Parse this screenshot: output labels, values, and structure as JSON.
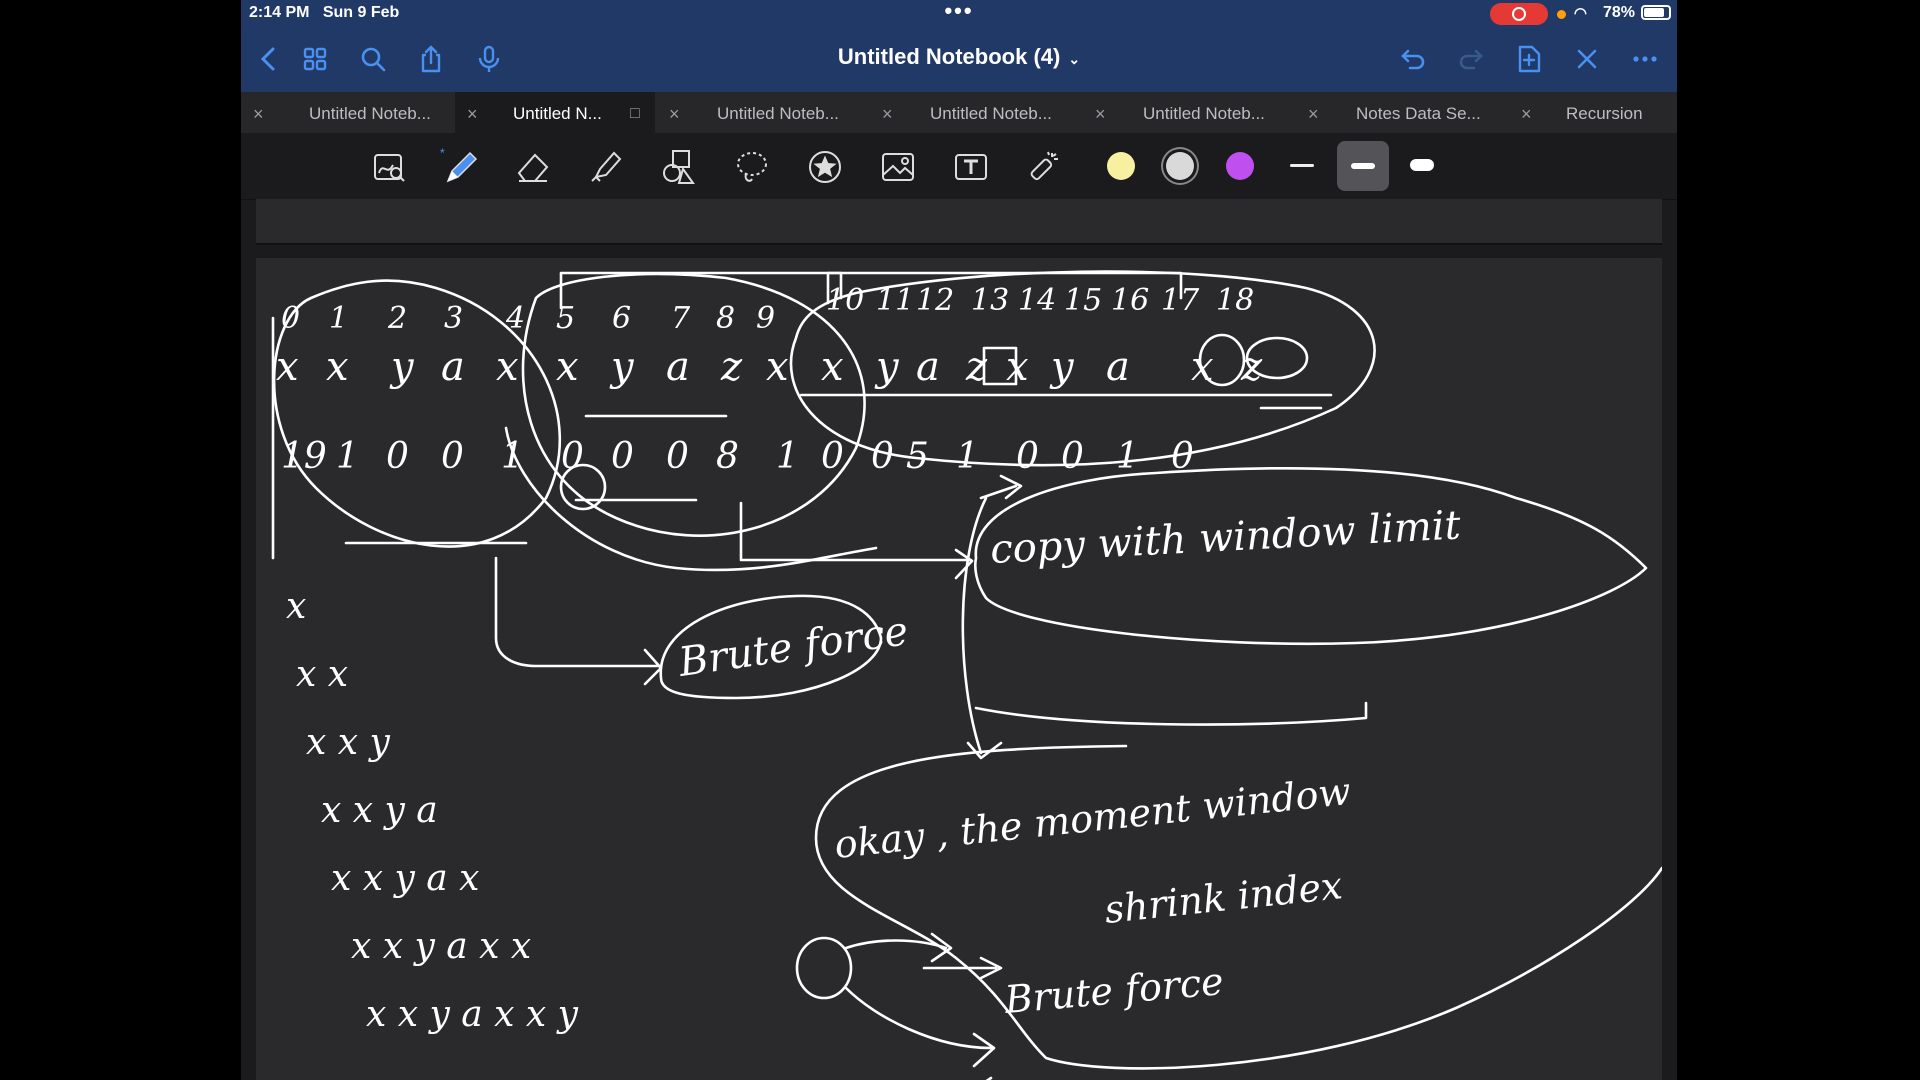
{
  "status": {
    "time": "2:14 PM",
    "date": "Sun 9 Feb",
    "battery": "78%"
  },
  "nav": {
    "title": "Untitled Notebook (4)"
  },
  "tabs": [
    {
      "label": "Untitled Noteb...",
      "active": false
    },
    {
      "label": "Untitled N...",
      "active": true
    },
    {
      "label": "Untitled Noteb...",
      "active": false
    },
    {
      "label": "Untitled Noteb...",
      "active": false
    },
    {
      "label": "Untitled Noteb...",
      "active": false
    },
    {
      "label": "Notes Data Se...",
      "active": false
    },
    {
      "label": "Recursion",
      "active": false
    }
  ],
  "toolbar": {
    "tools": [
      "zoom-window-icon",
      "pen-icon",
      "eraser-icon",
      "highlighter-icon",
      "shapes-icon",
      "lasso-icon",
      "sticker-icon",
      "image-icon",
      "text-icon",
      "laser-pointer-icon"
    ],
    "colors": [
      "#f7f0a0",
      "#d9d9d9",
      "#c04ff0"
    ]
  },
  "canvas": {
    "indices_row1": [
      "0",
      "1",
      "2",
      "3",
      "4",
      "5",
      "6",
      "7",
      "8",
      "9"
    ],
    "indices_row2": [
      "10",
      "11",
      "12",
      "13",
      "14",
      "15",
      "16",
      "17",
      "18"
    ],
    "chars": [
      "x",
      "x",
      "y",
      "a",
      "x",
      "x",
      "y",
      "a",
      "z",
      "x",
      "x",
      "y",
      "a",
      "z",
      "x",
      "y",
      "a",
      "x",
      "z"
    ],
    "bits_row": [
      "19",
      "1",
      "0",
      "0",
      "1",
      "0",
      "0",
      "0",
      "8",
      "1",
      "0",
      "0",
      "5",
      "1",
      "0",
      "0",
      "1",
      "0"
    ],
    "note_copy_window": "copy with window limit",
    "note_brute_force": "Brute force",
    "note_moment": "okay , the moment window",
    "note_shrink": "shrink index",
    "note_brute_force2": "Brute force",
    "prefix_list": [
      "x",
      "x x",
      "x x y",
      "x x y a",
      "x x y a x",
      "x x y a x x",
      "x x y a x x y"
    ]
  }
}
